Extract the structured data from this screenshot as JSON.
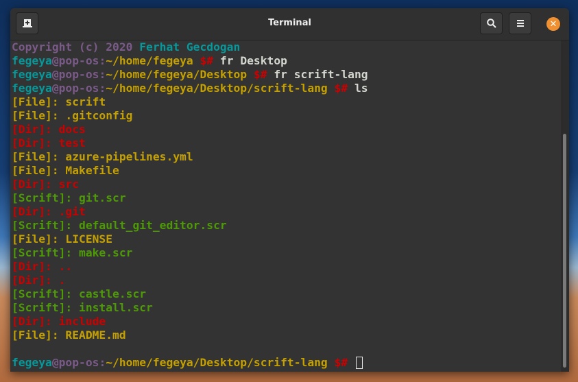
{
  "window": {
    "title": "Terminal"
  },
  "header": {
    "new_tab_icon": "new-tab-icon",
    "search_icon": "search-icon",
    "menu_icon": "hamburger-menu-icon",
    "close_icon": "close-icon",
    "close_glyph": "✕"
  },
  "colors": {
    "purple": "#7a5a88",
    "teal": "#06989a",
    "yellow": "#c4a000",
    "red": "#cc0000",
    "green": "#4e9a06",
    "white": "#d3d7cf",
    "accent": "#f09030"
  },
  "terminal": {
    "lines": [
      [
        {
          "t": "Copyright (c) 2020 ",
          "c": "purple"
        },
        {
          "t": "Ferhat Gecdogan",
          "c": "teal"
        }
      ],
      [
        {
          "t": "fegeya",
          "c": "teal"
        },
        {
          "t": "@pop-os:",
          "c": "purple"
        },
        {
          "t": "~/home/fegeya ",
          "c": "yellow"
        },
        {
          "t": "$# ",
          "c": "red"
        },
        {
          "t": "fr Desktop",
          "c": "white"
        }
      ],
      [
        {
          "t": "fegeya",
          "c": "teal"
        },
        {
          "t": "@pop-os:",
          "c": "purple"
        },
        {
          "t": "~/home/fegeya/Desktop ",
          "c": "yellow"
        },
        {
          "t": "$# ",
          "c": "red"
        },
        {
          "t": "fr scrift-lang",
          "c": "white"
        }
      ],
      [
        {
          "t": "fegeya",
          "c": "teal"
        },
        {
          "t": "@pop-os:",
          "c": "purple"
        },
        {
          "t": "~/home/fegeya/Desktop/scrift-lang ",
          "c": "yellow"
        },
        {
          "t": "$# ",
          "c": "red"
        },
        {
          "t": "ls",
          "c": "white"
        }
      ],
      [
        {
          "t": "[File]: scrift",
          "c": "yellow"
        }
      ],
      [
        {
          "t": "[File]: .gitconfig",
          "c": "yellow"
        }
      ],
      [
        {
          "t": "[Dir]: docs",
          "c": "red"
        }
      ],
      [
        {
          "t": "[Dir]: test",
          "c": "red"
        }
      ],
      [
        {
          "t": "[File]: azure-pipelines.yml",
          "c": "yellow"
        }
      ],
      [
        {
          "t": "[File]: Makefile",
          "c": "yellow"
        }
      ],
      [
        {
          "t": "[Dir]: src",
          "c": "red"
        }
      ],
      [
        {
          "t": "[Scrift]: git.scr",
          "c": "green"
        }
      ],
      [
        {
          "t": "[Dir]: .git",
          "c": "red"
        }
      ],
      [
        {
          "t": "[Scrift]: default_git_editor.scr",
          "c": "green"
        }
      ],
      [
        {
          "t": "[File]: LICENSE",
          "c": "yellow"
        }
      ],
      [
        {
          "t": "[Scrift]: make.scr",
          "c": "green"
        }
      ],
      [
        {
          "t": "[Dir]: ..",
          "c": "red"
        }
      ],
      [
        {
          "t": "[Dir]: .",
          "c": "red"
        }
      ],
      [
        {
          "t": "[Scrift]: castle.scr",
          "c": "green"
        }
      ],
      [
        {
          "t": "[Scrift]: install.scr",
          "c": "green"
        }
      ],
      [
        {
          "t": "[Dir]: include",
          "c": "red"
        }
      ],
      [
        {
          "t": "[File]: README.md",
          "c": "yellow"
        }
      ],
      [],
      [
        {
          "t": "fegeya",
          "c": "teal"
        },
        {
          "t": "@pop-os:",
          "c": "purple"
        },
        {
          "t": "~/home/fegeya/Desktop/scrift-lang ",
          "c": "yellow"
        },
        {
          "t": "$# ",
          "c": "red"
        }
      ]
    ]
  }
}
